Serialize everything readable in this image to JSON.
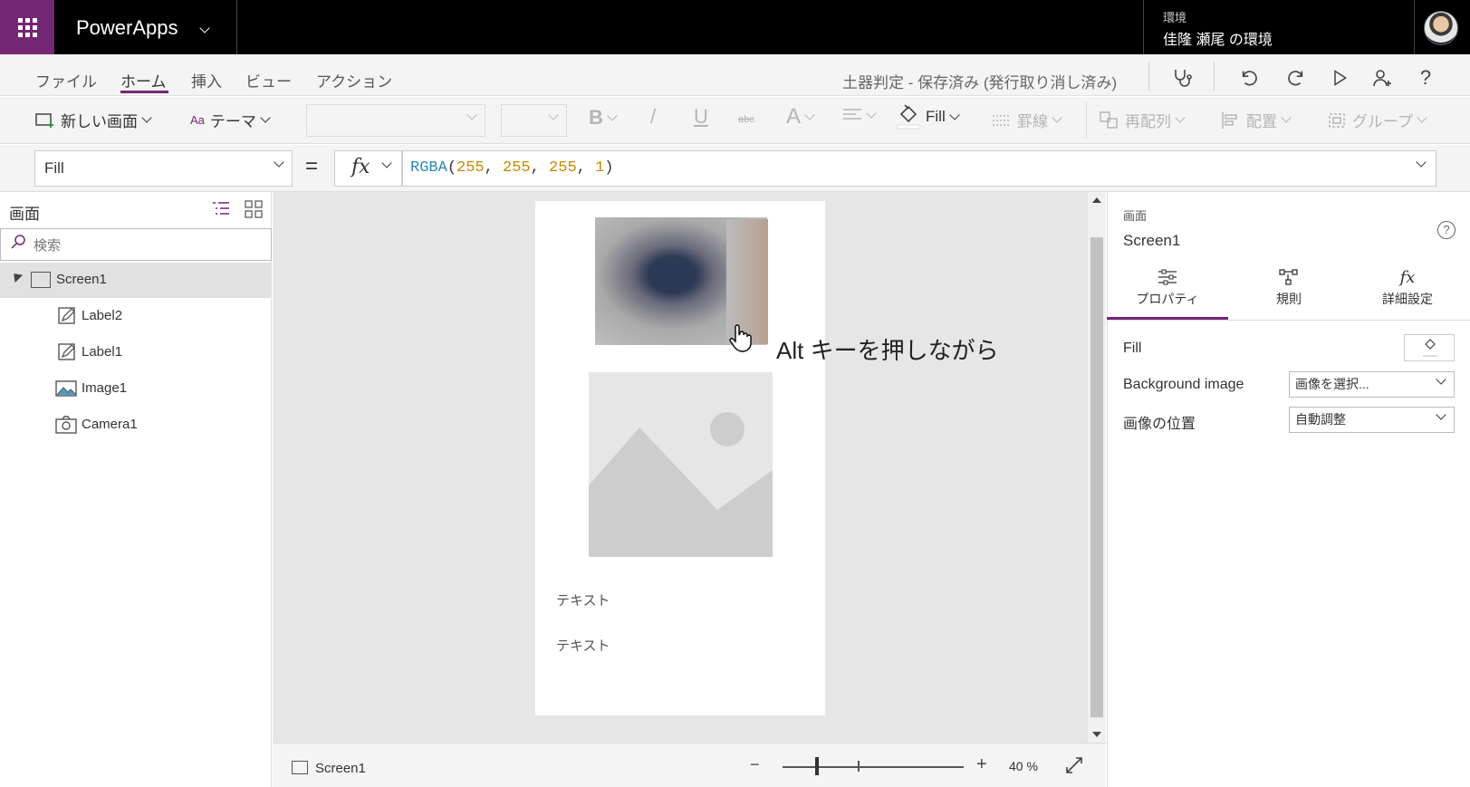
{
  "topbar": {
    "app_name": "PowerApps",
    "env_label": "環境",
    "env_name": "佳隆 瀬尾 の環境"
  },
  "menu": {
    "items": [
      "ファイル",
      "ホーム",
      "挿入",
      "ビュー",
      "アクション"
    ],
    "active": "ホーム",
    "doc_status": "土器判定 - 保存済み (発行取り消し済み)"
  },
  "ribbon": {
    "new_screen": "新しい画面",
    "theme": "テーマ",
    "bold": "B",
    "italic": "/",
    "underline": "U",
    "strike": "abc",
    "font_color": "A",
    "fill": "Fill",
    "border": "罫線",
    "reorder": "再配列",
    "align": "配置",
    "group": "グループ"
  },
  "formula": {
    "property": "Fill",
    "equals": "=",
    "fx": "fx",
    "fn": "RGBA",
    "args": [
      "255",
      "255",
      "255",
      "1"
    ]
  },
  "left_panel": {
    "title": "画面",
    "search_placeholder": "検索",
    "tree": [
      {
        "label": "Screen1",
        "icon": "screen-icon",
        "level": 0
      },
      {
        "label": "Label2",
        "icon": "label-icon",
        "level": 1
      },
      {
        "label": "Label1",
        "icon": "label-icon",
        "level": 1
      },
      {
        "label": "Image1",
        "icon": "image-icon",
        "level": 1
      },
      {
        "label": "Camera1",
        "icon": "camera-icon",
        "level": 1
      }
    ]
  },
  "canvas": {
    "hint": "Alt キーを押しながら",
    "label_text_1": "テキスト",
    "label_text_2": "テキスト"
  },
  "bottom_bar": {
    "screen_name": "Screen1",
    "zoom_minus": "−",
    "zoom_plus": "+",
    "zoom_value": "40 %",
    "zoom_level": 0.4
  },
  "right_panel": {
    "type_label": "画面",
    "name": "Screen1",
    "help": "?",
    "tabs": [
      "プロパティ",
      "規則",
      "詳細設定"
    ],
    "active_tab": "プロパティ",
    "props": {
      "fill_label": "Fill",
      "bg_image_label": "Background image",
      "bg_image_value": "画像を選択...",
      "image_pos_label": "画像の位置",
      "image_pos_value": "自動調整"
    }
  },
  "colors": {
    "brand": "#742774",
    "topbar": "#000000",
    "formula_fn": "#2a8ab5",
    "formula_num": "#c28a00"
  }
}
